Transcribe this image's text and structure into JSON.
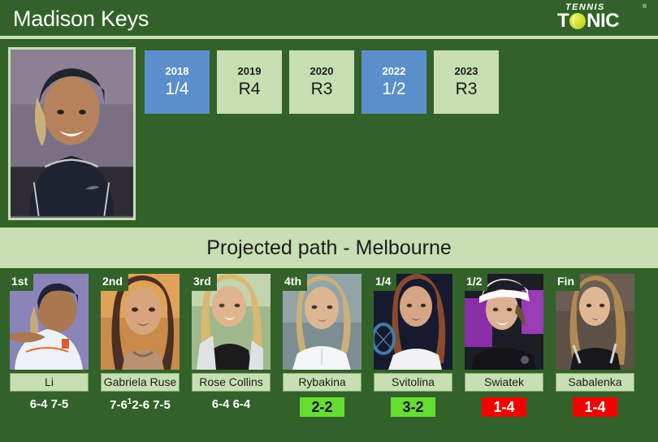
{
  "header": {
    "player_name": "Madison Keys",
    "logo": {
      "top_text": "TENNIS",
      "main_pre": "T",
      "main_post": "NIC",
      "registered": "®",
      "ball_icon": "tennis-ball-icon"
    }
  },
  "top_panel": {
    "photo_alt": "Madison Keys portrait",
    "years": [
      {
        "year": "2018",
        "result": "1/4",
        "highlight": true
      },
      {
        "year": "2019",
        "result": "R4",
        "highlight": false
      },
      {
        "year": "2020",
        "result": "R3",
        "highlight": false
      },
      {
        "year": "2022",
        "result": "1/2",
        "highlight": true
      },
      {
        "year": "2023",
        "result": "R3",
        "highlight": false
      }
    ]
  },
  "projected": {
    "band_title": "Projected path - Melbourne",
    "cards": [
      {
        "round": "1st",
        "name": "Li",
        "score": "6-4 7-5",
        "score_sup": "",
        "score_tail": "",
        "h2h": "",
        "h2h_state": ""
      },
      {
        "round": "2nd",
        "name": "Gabriela Ruse",
        "score": "7-6",
        "score_sup": "1",
        "score_tail": "2-6 7-5",
        "h2h": "",
        "h2h_state": ""
      },
      {
        "round": "3rd",
        "name": "Rose Collins",
        "score": "6-4 6-4",
        "score_sup": "",
        "score_tail": "",
        "h2h": "",
        "h2h_state": ""
      },
      {
        "round": "4th",
        "name": "Rybakina",
        "score": "",
        "score_sup": "",
        "score_tail": "",
        "h2h": "2-2",
        "h2h_state": "win"
      },
      {
        "round": "1/4",
        "name": "Svitolina",
        "score": "",
        "score_sup": "",
        "score_tail": "",
        "h2h": "3-2",
        "h2h_state": "win"
      },
      {
        "round": "1/2",
        "name": "Swiatek",
        "score": "",
        "score_sup": "",
        "score_tail": "",
        "h2h": "1-4",
        "h2h_state": "loss"
      },
      {
        "round": "Fin",
        "name": "Sabalenka",
        "score": "",
        "score_sup": "",
        "score_tail": "",
        "h2h": "1-4",
        "h2h_state": "loss"
      }
    ]
  },
  "colors": {
    "background_green": "#326229",
    "panel_light_green": "#c7dfb3",
    "highlight_blue": "#5b8fcb",
    "h2h_win_green": "#66dd33",
    "h2h_loss_red": "#f20000"
  }
}
